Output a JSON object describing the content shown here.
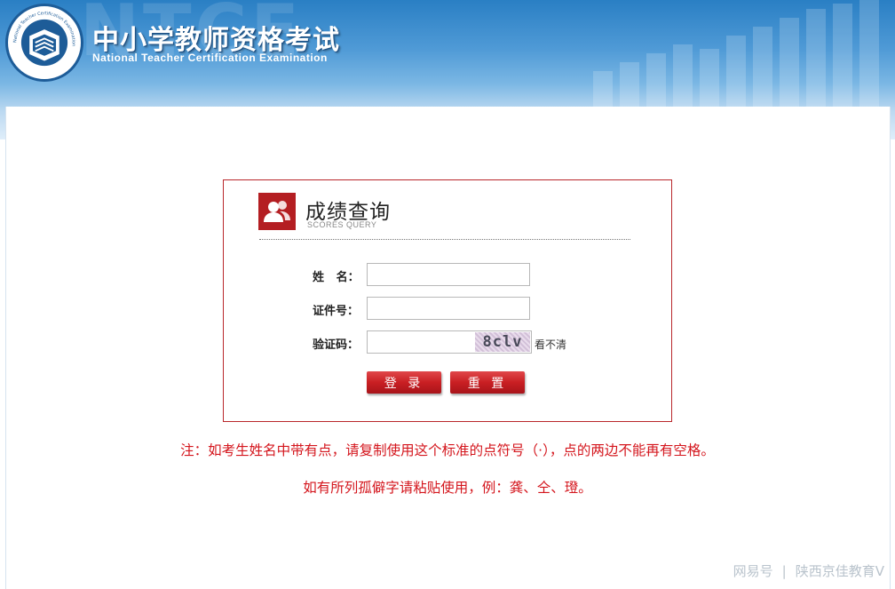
{
  "header": {
    "title": "中小学教师资格考试",
    "subtitle": "National Teacher Certification Examination",
    "watermark": "NTCE",
    "logo_ring_text": "National Teacher Certification Examination",
    "logo_top_text": "教 师 资 格 考 试"
  },
  "scores_box": {
    "title": "成绩查询",
    "subtitle": "SCORES QUERY",
    "fields": {
      "name": {
        "label": "姓   名：",
        "value": "",
        "placeholder": ""
      },
      "id_number": {
        "label": "证件号：",
        "value": "",
        "placeholder": ""
      },
      "captcha": {
        "label": "验证码：",
        "value": "",
        "placeholder": "",
        "image_text": "8clv",
        "refresh_label": "看不清"
      }
    },
    "buttons": {
      "login": "登 录",
      "reset": "重 置"
    }
  },
  "notes": [
    "注：如考生姓名中带有点，请复制使用这个标准的点符号（·），点的两边不能再有空格。",
    "如有所列孤僻字请粘贴使用，例：龚、仝、璒。"
  ],
  "footer": {
    "watermark_left": "网易号",
    "watermark_right": "陕西京佳教育V"
  },
  "colors": {
    "accent_red": "#b41e22",
    "note_red": "#d4161d",
    "header_blue": "#2a7fc4"
  }
}
